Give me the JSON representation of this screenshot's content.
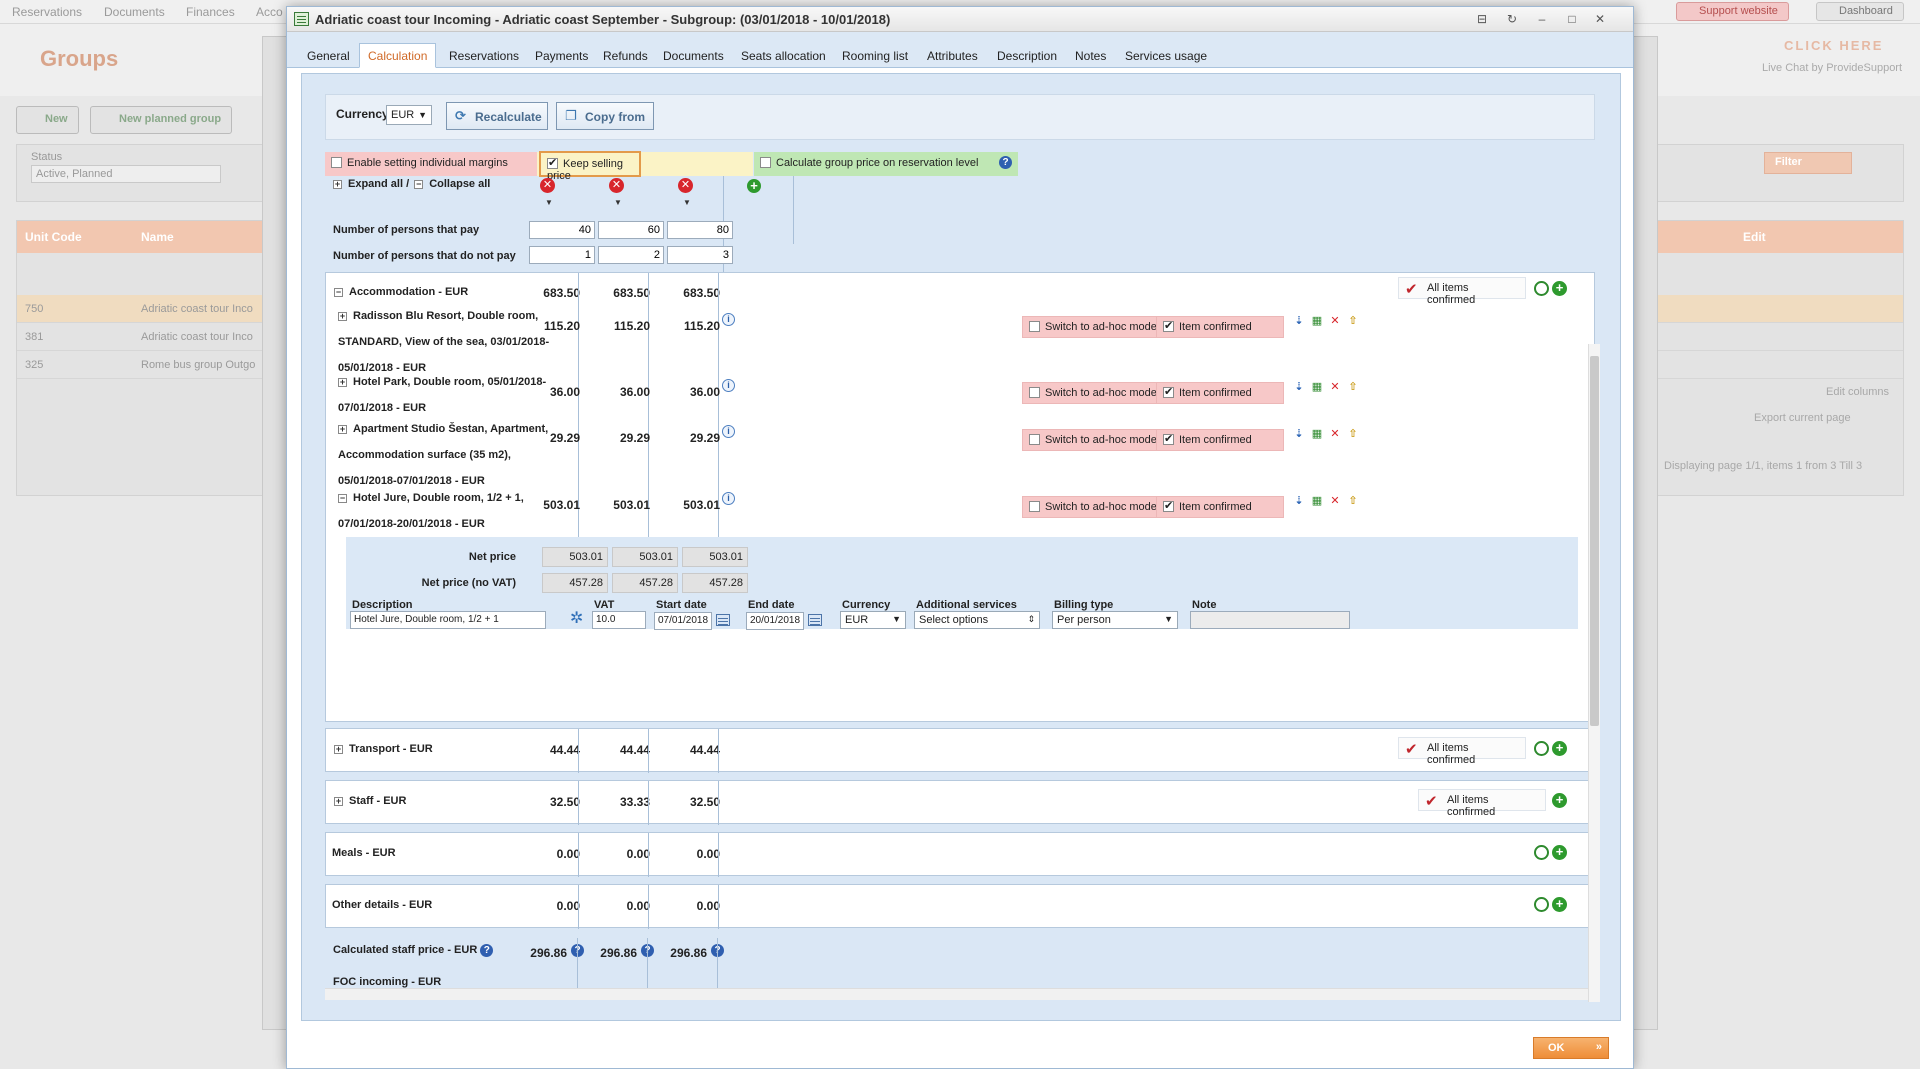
{
  "background": {
    "nav": [
      "Reservations",
      "Documents",
      "Finances",
      "Acco"
    ],
    "support_label": "Support website",
    "dashboard_label": "Dashboard",
    "page_title": "Groups",
    "click_here": "CLICK HERE",
    "live_chat": "Live Chat by ProvideSupport",
    "new_label": "New",
    "new_planned_label": "New planned group",
    "status_label": "Status",
    "status_value": "Active, Planned",
    "filter_label": "Filter",
    "grid_headers": {
      "unit_code": "Unit Code",
      "name": "Name",
      "edit": "Edit"
    },
    "rows": [
      {
        "code": "750",
        "name": "Adriatic coast tour Inco"
      },
      {
        "code": "381",
        "name": "Adriatic coast tour Inco"
      },
      {
        "code": "325",
        "name": "Rome bus group Outgo"
      }
    ],
    "edit_columns": "Edit columns",
    "export_current_page": "Export current page",
    "pager_page": "1",
    "displaying": "Displaying page 1/1, items 1 from 3 Till 3"
  },
  "modal": {
    "title": "Adriatic coast tour Incoming - Adriatic coast September - Subgroup: (03/01/2018 - 10/01/2018)",
    "tabs": [
      "General",
      "Calculation",
      "Reservations",
      "Payments",
      "Refunds",
      "Documents",
      "Seats allocation",
      "Rooming list",
      "Attributes",
      "Description",
      "Notes",
      "Services usage"
    ],
    "active_tab": "Calculation",
    "currency_label": "Currency:",
    "currency_value": "EUR",
    "recalculate_label": "Recalculate",
    "copy_from_label": "Copy from",
    "opt_individual_margins": "Enable setting individual margins",
    "opt_keep_selling_price": "Keep selling price",
    "opt_group_price_reservation": "Calculate group price on reservation level",
    "expand_all": "Expand all /",
    "collapse_all": "Collapse all",
    "persons_pay_label": "Number of persons that pay",
    "persons_pay": [
      "40",
      "60",
      "80"
    ],
    "persons_not_pay_label": "Number of persons that do not pay",
    "persons_not_pay": [
      "1",
      "2",
      "3"
    ],
    "all_items_confirmed": "All items confirmed",
    "switch_adhoc": "Switch to ad-hoc mode",
    "item_confirmed": "Item confirmed",
    "sections": {
      "accommodation": {
        "title": "Accommodation - EUR",
        "values": [
          "683.50",
          "683.50",
          "683.50"
        ],
        "items": [
          {
            "name": "Radisson Blu Resort, Double room, STANDARD, View of the sea, 03/01/2018-05/01/2018 - EUR",
            "values": [
              "115.20",
              "115.20",
              "115.20"
            ]
          },
          {
            "name": "Hotel Park, Double room, 05/01/2018-07/01/2018 - EUR",
            "values": [
              "36.00",
              "36.00",
              "36.00"
            ]
          },
          {
            "name": "Apartment Studio Šestan, Apartment, Accommodation surface (35 m2), 05/01/2018-07/01/2018 - EUR",
            "values": [
              "29.29",
              "29.29",
              "29.29"
            ]
          },
          {
            "name": "Hotel Jure, Double room, 1/2 + 1, 07/01/2018-20/01/2018 - EUR",
            "values": [
              "503.01",
              "503.01",
              "503.01"
            ]
          }
        ]
      },
      "detail": {
        "net_price_label": "Net price",
        "net_price": [
          "503.01",
          "503.01",
          "503.01"
        ],
        "net_price_novat_label": "Net price (no VAT)",
        "net_price_novat": [
          "457.28",
          "457.28",
          "457.28"
        ],
        "description_label": "Description",
        "description_value": "Hotel Jure, Double room, 1/2 + 1",
        "vat_label": "VAT",
        "vat_value": "10.0",
        "start_date_label": "Start date",
        "start_date_value": "07/01/2018",
        "end_date_label": "End date",
        "end_date_value": "20/01/2018",
        "currency_label": "Currency",
        "currency_value": "EUR",
        "additional_services_label": "Additional services",
        "additional_services_value": "Select options",
        "billing_type_label": "Billing type",
        "billing_type_value": "Per person",
        "note_label": "Note"
      },
      "transport": {
        "title": "Transport - EUR",
        "values": [
          "44.44",
          "44.44",
          "44.44"
        ]
      },
      "staff": {
        "title": "Staff - EUR",
        "values": [
          "32.50",
          "33.33",
          "32.50"
        ]
      },
      "meals": {
        "title": "Meals - EUR",
        "values": [
          "0.00",
          "0.00",
          "0.00"
        ]
      },
      "other": {
        "title": "Other details - EUR",
        "values": [
          "0.00",
          "0.00",
          "0.00"
        ]
      }
    },
    "calc_staff_label": "Calculated staff price - EUR",
    "calc_staff_values": [
      "296.86",
      "296.86",
      "296.86"
    ],
    "foc_label": "FOC incoming - EUR",
    "ok_label": "OK"
  }
}
